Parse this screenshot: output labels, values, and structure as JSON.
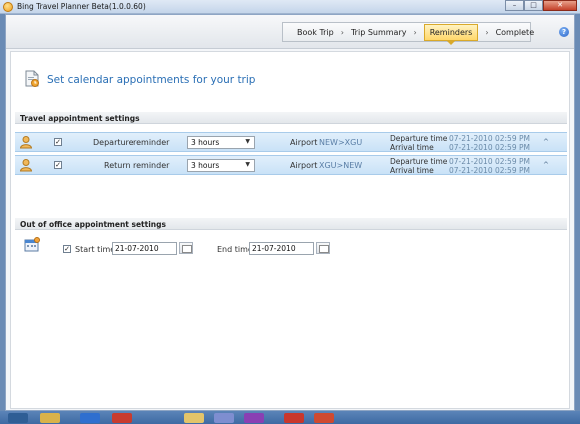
{
  "window": {
    "title": "Bing Travel Planner Beta(1.0.0.60)",
    "controls": {
      "minimize": "–",
      "maximize": "□",
      "close": "✕"
    }
  },
  "wizard": {
    "steps": [
      {
        "label": "Book Trip",
        "active": false
      },
      {
        "label": "Trip Summary",
        "active": false
      },
      {
        "label": "Reminders",
        "active": true
      },
      {
        "label": "Complete",
        "active": false
      }
    ],
    "separator": "›",
    "help_glyph": "?"
  },
  "page": {
    "title": "Set calendar appointments for your trip"
  },
  "travel": {
    "heading": "Travel appointment settings",
    "rows": [
      {
        "checked": "✓",
        "direction": "Departure",
        "reminder_label": "reminder",
        "reminder": "3 hours",
        "place_label": "Airport",
        "route": "NEW>XGU",
        "departure_label": "Departure time",
        "departure_value": "07-21-2010 02:59 PM",
        "arrival_label": "Arrival time",
        "arrival_value": "07-21-2010 02:59 PM",
        "toggle": "^"
      },
      {
        "checked": "✓",
        "direction": "Return",
        "reminder_label": "reminder",
        "reminder": "3 hours",
        "place_label": "Airport",
        "route": "XGU>NEW",
        "departure_label": "Departure time",
        "departure_value": "07-21-2010 02:59 PM",
        "arrival_label": "Arrival time",
        "arrival_value": "07-21-2010 02:59 PM",
        "toggle": "^"
      }
    ]
  },
  "ooo": {
    "heading": "Out of office appointment settings",
    "checked": "✓",
    "start_label": "Start time",
    "start_value": "21-07-2010",
    "end_label": "End time",
    "end_value": "21-07-2010"
  },
  "colors": {
    "accent": "#2a6fb5",
    "row_bg": "#c9e2f7",
    "active_step": "#ffd76a"
  },
  "icons": [
    "app-icon",
    "help-icon",
    "calendar-reminder-icon",
    "person-icon",
    "out-of-office-icon",
    "calendar-picker-icon"
  ]
}
